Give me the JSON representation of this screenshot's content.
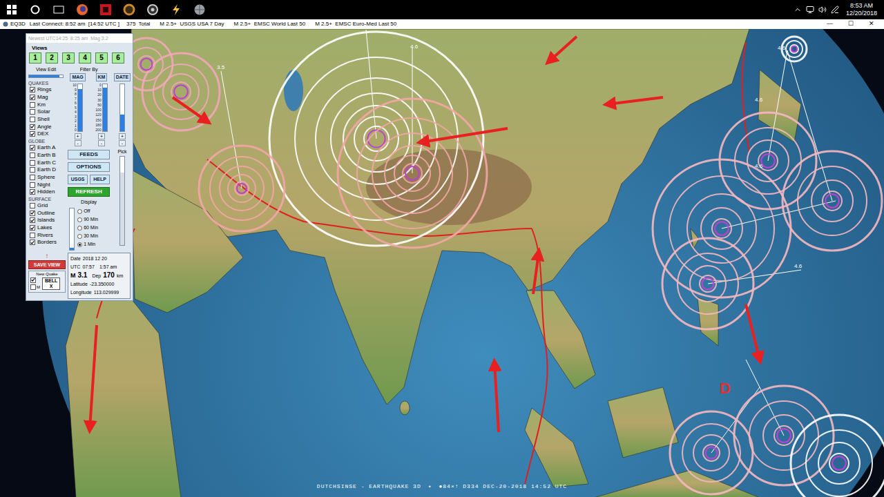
{
  "taskbar": {
    "time": "8:53 AM",
    "date": "12/20/2018"
  },
  "window": {
    "title": "EQ3D",
    "status": "Last Connect: 8:52 am  [14:52 UTC ]",
    "total": "375",
    "total_label": "Total",
    "feeds": [
      "M 2.5+  USGS USA 7 Day",
      "M 2.5+  EMSC World Last 50",
      "M 2.5+  EMSC Euro-Med Last 50"
    ],
    "controls": [
      "—",
      "☐",
      "✕"
    ]
  },
  "panel": {
    "header": "Newest UTC14:25  8:25 am  Mag 3.2",
    "views_label": "Views",
    "views": [
      "1",
      "2",
      "3",
      "4",
      "5",
      "6"
    ],
    "view_edit": {
      "label": "View Edit",
      "level": 0.9
    },
    "filter_label": "Filter By",
    "filters": [
      {
        "label": "MAG",
        "level": 0.9,
        "ticks": [
          "10",
          "9",
          "8",
          "7",
          "6",
          "5",
          "4",
          "3",
          "2",
          "1",
          "0"
        ]
      },
      {
        "label": "KM",
        "level": 0.92,
        "ticks": [
          "0",
          "10",
          "20",
          "30",
          "50",
          "100",
          "120",
          "150",
          "180",
          "200"
        ]
      },
      {
        "label": "DATE",
        "level": 0.35,
        "ticks": []
      }
    ],
    "steppers": [
      "+",
      "-"
    ],
    "groups": [
      {
        "title": "QUAKES",
        "items": [
          {
            "label": "Rings",
            "checked": true
          },
          {
            "label": "Mag",
            "checked": true
          },
          {
            "label": "Km",
            "checked": false
          },
          {
            "label": "Solar",
            "checked": false
          },
          {
            "label": "Shell",
            "checked": false
          },
          {
            "label": "Angle",
            "checked": true
          },
          {
            "label": "DEX",
            "checked": true
          }
        ]
      },
      {
        "title": "GLOBE",
        "items": [
          {
            "label": "Earth A",
            "checked": true
          },
          {
            "label": "Earth B",
            "checked": false
          },
          {
            "label": "Earth C",
            "checked": false
          },
          {
            "label": "Earth D",
            "checked": false
          },
          {
            "label": "Sphere",
            "checked": false
          },
          {
            "label": "Night",
            "checked": false
          },
          {
            "label": "Hidden",
            "checked": true
          }
        ]
      },
      {
        "title": "SURFACE",
        "items": [
          {
            "label": "Grid",
            "checked": false
          },
          {
            "label": "Outline",
            "checked": true
          },
          {
            "label": "Islands",
            "checked": true
          },
          {
            "label": "Lakes",
            "checked": true
          },
          {
            "label": "Rivers",
            "checked": false
          },
          {
            "label": "Borders",
            "checked": true
          }
        ]
      }
    ],
    "buttons": {
      "feeds": "FEEDS",
      "options": "OPTIONS",
      "usgs": "USGS",
      "help": "HELP",
      "refresh": "REFRESH"
    },
    "display": {
      "label": "Display",
      "level": 0.05,
      "options": [
        {
          "label": "Off",
          "selected": false
        },
        {
          "label": "90 Min",
          "selected": false
        },
        {
          "label": "60 Min",
          "selected": false
        },
        {
          "label": "30 Min",
          "selected": false
        },
        {
          "label": "1 Min",
          "selected": true
        }
      ]
    },
    "pick": {
      "label": "Pick",
      "level": 0.82
    },
    "save_arrow": "↑",
    "save_view": "SAVE VIEW",
    "new_quake": {
      "label": "New Quake",
      "options": [
        {
          "label": "",
          "checked": true
        },
        {
          "label": "M",
          "checked": false
        }
      ],
      "bell": "BELL",
      "bell_x": "X"
    },
    "info": [
      {
        "label": "Date",
        "value": "2018 12 20",
        "extra": "",
        "extra_value": "",
        "unit": "",
        "emphasis": false
      },
      {
        "label": "UTC",
        "value": "07:57",
        "extra": "1:57 am",
        "extra_value": "",
        "unit": "",
        "emphasis": false
      },
      {
        "label": "M",
        "value": "3.1",
        "extra": "Dep",
        "extra_value": "170",
        "unit": "km",
        "emphasis": true
      },
      {
        "label": "Latitude",
        "value": "-23.350000",
        "extra": "",
        "extra_value": "",
        "unit": "",
        "emphasis": false
      },
      {
        "label": "Longitude",
        "value": "113.029999",
        "extra": "",
        "extra_value": "",
        "unit": "",
        "emphasis": false
      }
    ]
  },
  "map": {
    "labels": [
      {
        "text": "3.5",
        "color": "#ffffff"
      },
      {
        "text": "4.6",
        "color": "#ffffff"
      },
      {
        "text": "4.6",
        "color": "#ffffff"
      },
      {
        "text": "4.6",
        "color": "#ffffff"
      },
      {
        "text": "4.6",
        "color": "#ffffff"
      },
      {
        "text": "4.6",
        "color": "#ffffff"
      },
      {
        "text": "D",
        "color": "#e03030"
      }
    ],
    "footer": [
      "DUTCHSINSE - EARTHQUAKE 3D",
      "✦",
      "●84×↑ D334 DEC-20-2018 14:52 UTC"
    ]
  }
}
